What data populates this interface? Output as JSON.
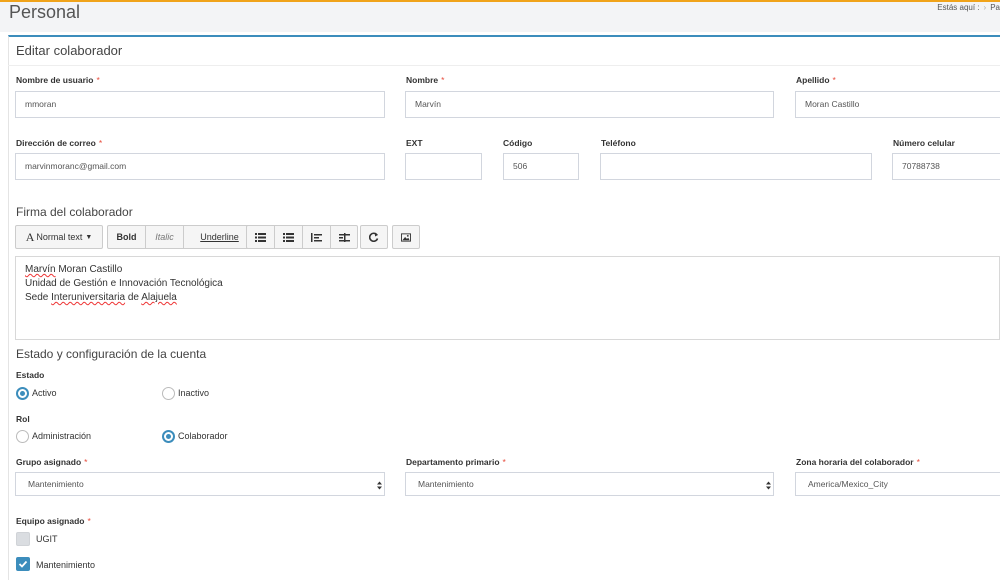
{
  "header": {
    "title": "Personal",
    "breadcrumb_prefix": "Estás aquí :",
    "breadcrumb_item": "Pa"
  },
  "panel": {
    "title": "Editar colaborador"
  },
  "fields": {
    "username": {
      "label": "Nombre de usuario",
      "value": "mmoran"
    },
    "first_name": {
      "label": "Nombre",
      "value": "Marvín"
    },
    "last_name": {
      "label": "Apellido",
      "value": "Moran Castillo"
    },
    "email": {
      "label": "Dirección de correo",
      "value": "marvinmoranc@gmail.com"
    },
    "ext": {
      "label": "EXT",
      "value": ""
    },
    "code": {
      "label": "Código",
      "value": "506"
    },
    "phone": {
      "label": "Teléfono",
      "value": ""
    },
    "mobile": {
      "label": "Número celular",
      "value": "70788738"
    }
  },
  "signature": {
    "title": "Firma del colaborador",
    "toolbar": {
      "normal_text": "Normal text",
      "bold": "Bold",
      "italic": "Italic",
      "underline": "Underline"
    },
    "lines": {
      "l1_a": "Marvín",
      "l1_b": " Moran Castillo",
      "l2": "Unidad de Gestión e Innovación Tecnológica",
      "l3_a": "Sede ",
      "l3_b": "Interuniversitaria",
      "l3_c": " de ",
      "l3_d": "Alajuela"
    }
  },
  "account": {
    "title": "Estado y configuración de la cuenta",
    "estado": {
      "label": "Estado",
      "options": [
        "Activo",
        "Inactivo"
      ],
      "selected": "Activo"
    },
    "rol": {
      "label": "Rol",
      "options": [
        "Administración",
        "Colaborador"
      ],
      "selected": "Colaborador"
    },
    "grupo": {
      "label": "Grupo asignado",
      "value": "Mantenimiento"
    },
    "departamento": {
      "label": "Departamento primario",
      "value": "Mantenimiento"
    },
    "zona": {
      "label": "Zona horaria del colaborador",
      "value": "America/Mexico_City"
    },
    "equipo": {
      "label": "Equipo asignado",
      "items": [
        {
          "label": "UGIT",
          "checked": false
        },
        {
          "label": "Mantenimiento",
          "checked": true
        }
      ]
    }
  },
  "colors": {
    "accent": "#3c8dbc",
    "top_bar": "#f0a31a",
    "required": "#e74c3c"
  }
}
